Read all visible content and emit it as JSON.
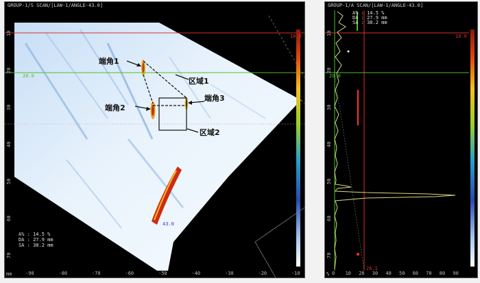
{
  "sscan": {
    "title": "GROUP-1/S SCAN/[LAW-1/ANGLE-43.0]",
    "depth_ticks": [
      "10",
      "20",
      "30",
      "40",
      "50",
      "60",
      "70"
    ],
    "x_ticks": [
      "-90",
      "-80",
      "-70",
      "-60",
      "-50",
      "-40",
      "-30",
      "-20",
      "-10"
    ],
    "x_unit": "mm",
    "ref_line_label": "10.0",
    "gate_line_label": "20.0",
    "angle_label": "43.0",
    "annotations": {
      "tip1": "端角1",
      "tip2": "端角2",
      "tip3": "端角3",
      "zone1": "区域1",
      "zone2": "区域2"
    },
    "readout": [
      {
        "key": "A%",
        "value": "14.5 %"
      },
      {
        "key": "DA",
        "value": "27.9 mm"
      },
      {
        "key": "SA",
        "value": "38.2 mm"
      }
    ]
  },
  "ascan": {
    "title": "GROUP-1/A SCAN/[LAW-1/ANGLE-43.0]",
    "depth_ticks": [
      "10",
      "20",
      "30",
      "40",
      "50",
      "60",
      "70"
    ],
    "x_ticks": [
      "0",
      "10",
      "20",
      "30",
      "40",
      "50",
      "60",
      "70",
      "80",
      "90"
    ],
    "x_unit": "%",
    "ref_line_label": "10.0",
    "gate_line_label": "20.0",
    "cursor_label": "26.1",
    "readout": [
      {
        "key": "A%",
        "value": "14.5 %"
      },
      {
        "key": "DA",
        "value": "27.9 mm"
      },
      {
        "key": "SA",
        "value": "38.2 mm"
      }
    ]
  },
  "colors": {
    "ref_line": "#d93030",
    "gate_line": "#4cc02a",
    "ascan_trace": "#d8d880",
    "sector_bg": "#e9f2fb"
  }
}
